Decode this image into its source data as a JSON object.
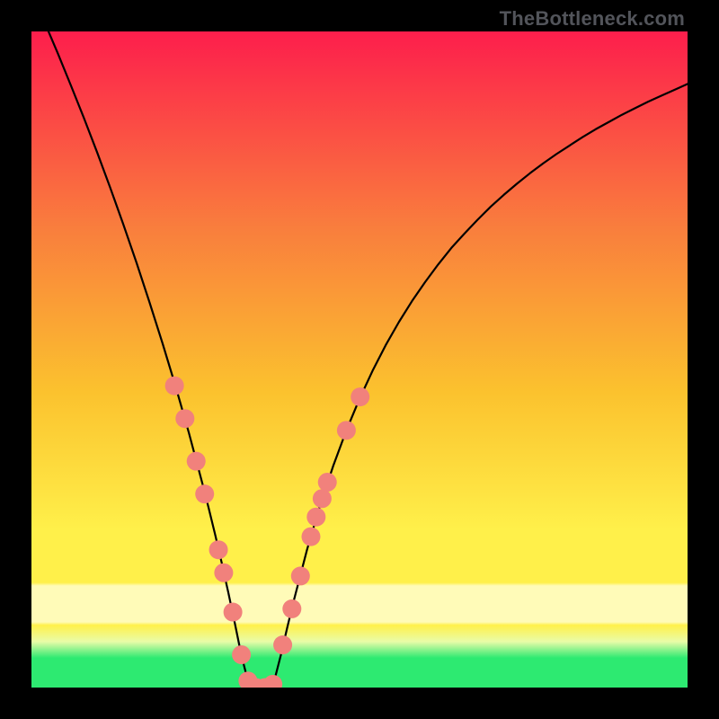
{
  "watermark": "TheBottleneck.com",
  "colors": {
    "black": "#000000",
    "curve": "#000000",
    "dot": "#f1817c",
    "gradient_top": "#fd1e4c",
    "gradient_mid_top": "#f97e3d",
    "gradient_mid": "#fbc22e",
    "gradient_low": "#fff04a",
    "gradient_band_light": "#fffbb8",
    "gradient_band_pale": "#e9fca8",
    "gradient_green": "#2dea71"
  },
  "chart_data": {
    "type": "line",
    "title": "",
    "xlabel": "",
    "ylabel": "",
    "xlim": [
      0,
      100
    ],
    "ylim": [
      0,
      100
    ],
    "x": [
      0,
      2,
      4,
      6,
      8,
      10,
      12,
      14,
      16,
      18,
      20,
      22,
      24,
      26,
      27,
      28,
      29,
      30,
      31,
      32,
      33,
      34,
      35,
      36,
      37,
      38,
      39,
      40,
      42,
      44,
      46,
      48,
      50,
      52,
      54,
      56,
      58,
      60,
      62,
      64,
      66,
      68,
      70,
      72,
      74,
      76,
      78,
      80,
      82,
      84,
      86,
      88,
      90,
      92,
      94,
      96,
      98,
      100
    ],
    "values": [
      106,
      101.4,
      96.7,
      91.8,
      86.8,
      81.6,
      76.2,
      70.6,
      64.8,
      58.7,
      52.4,
      45.8,
      38.8,
      31.3,
      27.4,
      23.3,
      19.0,
      14.5,
      9.8,
      4.9,
      1.0,
      0.2,
      0.0,
      0.2,
      1.0,
      4.9,
      9.2,
      13.3,
      21.0,
      27.8,
      33.8,
      39.2,
      44.0,
      48.3,
      52.2,
      55.7,
      58.9,
      61.8,
      64.5,
      67.0,
      69.2,
      71.3,
      73.3,
      75.1,
      76.8,
      78.4,
      79.9,
      81.3,
      82.6,
      83.9,
      85.1,
      86.2,
      87.3,
      88.3,
      89.3,
      90.2,
      91.1,
      92.0
    ],
    "dots": [
      {
        "x": 21.8,
        "y": 46.0
      },
      {
        "x": 23.4,
        "y": 41.0
      },
      {
        "x": 25.1,
        "y": 34.5
      },
      {
        "x": 26.4,
        "y": 29.5
      },
      {
        "x": 28.5,
        "y": 21.0
      },
      {
        "x": 29.3,
        "y": 17.5
      },
      {
        "x": 30.7,
        "y": 11.5
      },
      {
        "x": 32.0,
        "y": 5.0
      },
      {
        "x": 33.0,
        "y": 1.0
      },
      {
        "x": 34.2,
        "y": 0.0
      },
      {
        "x": 35.6,
        "y": 0.0
      },
      {
        "x": 36.8,
        "y": 0.5
      },
      {
        "x": 38.3,
        "y": 6.5
      },
      {
        "x": 39.7,
        "y": 12.0
      },
      {
        "x": 41.0,
        "y": 17.0
      },
      {
        "x": 42.6,
        "y": 23.0
      },
      {
        "x": 43.4,
        "y": 26.0
      },
      {
        "x": 44.3,
        "y": 28.8
      },
      {
        "x": 45.1,
        "y": 31.3
      },
      {
        "x": 48.0,
        "y": 39.2
      },
      {
        "x": 50.1,
        "y": 44.3
      }
    ]
  }
}
